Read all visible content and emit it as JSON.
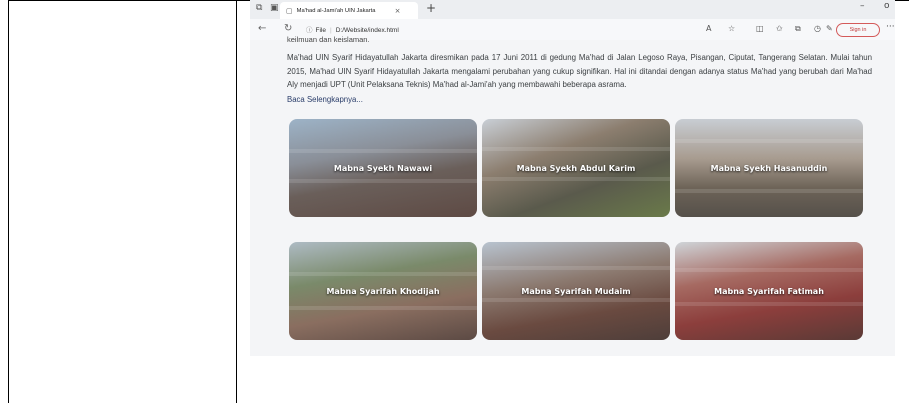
{
  "browser": {
    "tab_title": "Ma'had al-Jami'ah UIN Jakarta",
    "tab_close": "×",
    "new_tab": "+",
    "minimize": "–",
    "maximize": "o",
    "url_info_icon": "info-icon",
    "url_scheme": "File",
    "url_path": "D:/Website/index.html",
    "signin_label": "Sign in",
    "more": "···"
  },
  "page": {
    "cut_text": "keilmuan dan keislaman.",
    "paragraph": "Ma'had UIN Syarif Hidayatullah Jakarta diresmikan pada 17 Juni 2011 di gedung Ma'had di Jalan Legoso Raya, Pisangan, Ciputat, Tangerang Selatan. Mulai tahun 2015, Ma'had UIN Syarif Hidayatullah Jakarta mengalami perubahan yang cukup signifikan. Hal ini ditandai dengan adanya status Ma'had yang berubah dari Ma'had Aly menjadi UPT (Unit Pelaksana Teknis) Ma'had al-Jami'ah yang membawahi beberapa asrama.",
    "read_more": "Baca Selengkapnya...",
    "cards": [
      {
        "label": "Mabna Syekh Nawawi"
      },
      {
        "label": "Mabna Syekh Abdul Karim"
      },
      {
        "label": "Mabna Syekh Hasanuddin"
      },
      {
        "label": "Mabna Syarifah Khodijah"
      },
      {
        "label": "Mabna Syarifah Mudaim"
      },
      {
        "label": "Mabna Syarifah Fatimah"
      }
    ]
  },
  "colors": {
    "accent": "#2a3d6a",
    "signin": "#c03a3a",
    "content_bg": "#f4f5f7"
  }
}
